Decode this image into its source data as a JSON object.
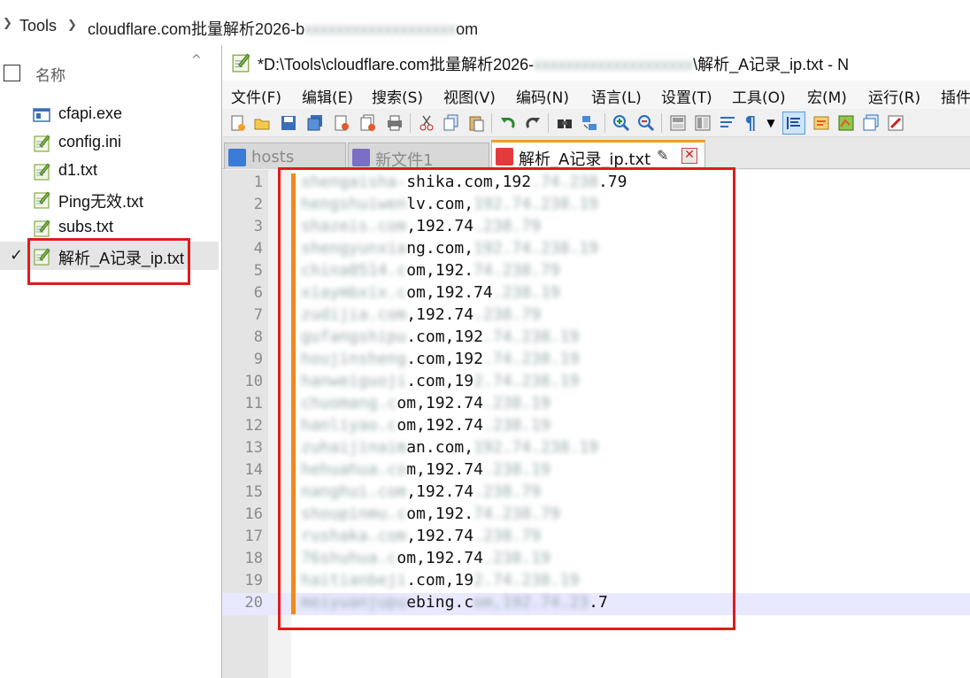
{
  "explorer": {
    "breadcrumb": {
      "segments": [
        "Tools",
        "cloudflare.com批量解析2026-b",
        "om"
      ],
      "separator": "›"
    },
    "header": {
      "name_label": "名称"
    },
    "files": [
      {
        "name": "cfapi.exe",
        "icon": "exe-icon"
      },
      {
        "name": "config.ini",
        "icon": "notepadpp-file-icon"
      },
      {
        "name": "d1.txt",
        "icon": "notepadpp-file-icon"
      },
      {
        "name": "Ping无效.txt",
        "icon": "notepadpp-file-icon"
      },
      {
        "name": "subs.txt",
        "icon": "notepadpp-file-icon"
      },
      {
        "name": "解析_A记录_ip.txt",
        "icon": "notepadpp-file-icon",
        "selected": true,
        "checked": true
      }
    ]
  },
  "notepad": {
    "title_prefix": "*D:\\Tools\\cloudflare.com批量解析2026-",
    "title_suffix": "\\解析_A记录_ip.txt - N",
    "menu": [
      "文件(F)",
      "编辑(E)",
      "搜索(S)",
      "视图(V)",
      "编码(N)",
      "语言(L)",
      "设置(T)",
      "工具(O)",
      "宏(M)",
      "运行(R)",
      "插件"
    ],
    "tabs": [
      {
        "label": "hosts",
        "state": "inactive",
        "icon_color": "#3a7bd5"
      },
      {
        "label": "新文件1",
        "state": "inactive",
        "icon_color": "#7a6fc4"
      },
      {
        "label": "解析_A记录_ip.txt",
        "state": "active",
        "icon_color": "#e23b3b"
      }
    ],
    "lines": [
      {
        "n": "1",
        "visible": "shika.com,192",
        "tail": ".79"
      },
      {
        "n": "2",
        "visible": "lv.com,",
        "tail": ""
      },
      {
        "n": "3",
        "visible": ",192.74",
        "tail": ""
      },
      {
        "n": "4",
        "visible": "ng.com,",
        "tail": ""
      },
      {
        "n": "5",
        "visible": "om,192.",
        "tail": ""
      },
      {
        "n": "6",
        "visible": "om,192.74",
        "tail": ""
      },
      {
        "n": "7",
        "visible": ",192.74",
        "tail": ""
      },
      {
        "n": "8",
        "visible": ".com,192",
        "tail": ""
      },
      {
        "n": "9",
        "visible": ".com,192",
        "tail": ""
      },
      {
        "n": "10",
        "visible": ".com,19",
        "tail": ""
      },
      {
        "n": "11",
        "visible": "om,192.74",
        "tail": ""
      },
      {
        "n": "12",
        "visible": "om,192.74",
        "tail": ""
      },
      {
        "n": "13",
        "visible": "an.com,",
        "tail": ""
      },
      {
        "n": "14",
        "visible": "m,192.74",
        "tail": ""
      },
      {
        "n": "15",
        "visible": ",192.74",
        "tail": ""
      },
      {
        "n": "16",
        "visible": "om,192.",
        "tail": ""
      },
      {
        "n": "17",
        "visible": ",192.74",
        "tail": ""
      },
      {
        "n": "18",
        "visible": "om,192.74",
        "tail": ""
      },
      {
        "n": "19",
        "visible": ".com,19",
        "tail": ""
      },
      {
        "n": "20",
        "visible": "ebing.c",
        "tail": ".7"
      }
    ]
  },
  "colors": {
    "highlight_red": "#e01b1b",
    "change_bar": "#f08a1c",
    "current_line": "#e8e8ff"
  }
}
